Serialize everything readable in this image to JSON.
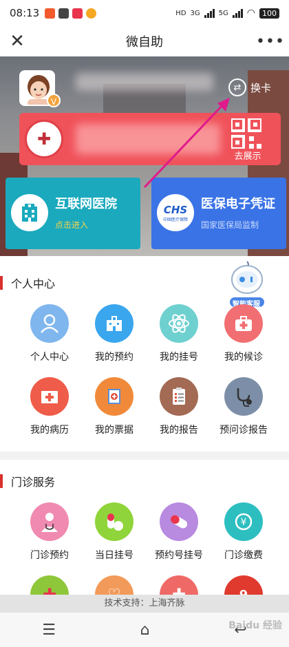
{
  "status_bar": {
    "time": "08:13",
    "network_labels": [
      "HD",
      "3G",
      "5G"
    ],
    "battery": "100"
  },
  "nav": {
    "title": "微自助",
    "close_icon": "close-icon",
    "more_icon": "more-icon"
  },
  "header": {
    "switch_label": "换卡",
    "show_label": "去展示"
  },
  "services": [
    {
      "title": "互联网医院",
      "subtitle": "点击进入",
      "color": "#1aa9bd",
      "subtitle_color": "#f7d34a"
    },
    {
      "title": "医保电子凭证",
      "subtitle": "国家医保局监制",
      "color": "#3a73e6",
      "subtitle_color": "#c9dafc",
      "logo_text": "CHS",
      "logo_sub": "中国医疗保障"
    }
  ],
  "personal": {
    "title": "个人中心",
    "items": [
      {
        "label": "个人中心",
        "icon": "person-icon",
        "color": "#7fb6ee"
      },
      {
        "label": "我的预约",
        "icon": "hospital-building-icon",
        "color": "#3aa6ee"
      },
      {
        "label": "我的挂号",
        "icon": "atom-icon",
        "color": "#6fd0d0"
      },
      {
        "label": "我的候诊",
        "icon": "first-aid-kit-icon",
        "color": "#f16f72"
      },
      {
        "label": "我的病历",
        "icon": "medical-record-icon",
        "color": "#ef5c4a"
      },
      {
        "label": "我的票据",
        "icon": "receipt-icon",
        "color": "#f08a3a"
      },
      {
        "label": "我的报告",
        "icon": "report-clipboard-icon",
        "color": "#a36a54"
      },
      {
        "label": "预问诊报告",
        "icon": "stethoscope-icon",
        "color": "#7d8fa8"
      }
    ]
  },
  "outpatient": {
    "title": "门诊服务",
    "items": [
      {
        "label": "门诊预约",
        "icon": "doctor-icon",
        "color": "#f08ab0"
      },
      {
        "label": "当日挂号",
        "icon": "pills-icon",
        "color": "#8fd43a"
      },
      {
        "label": "预约号挂号",
        "icon": "capsule-icon",
        "color": "#b88ae0"
      },
      {
        "label": "门诊缴费",
        "icon": "yuan-payment-icon",
        "color": "#2dbec0"
      },
      {
        "label": "",
        "icon": "hospital-cross-icon",
        "color": "#8fc73a"
      },
      {
        "label": "",
        "icon": "heartbeat-monitor-icon",
        "color": "#f29a5a"
      },
      {
        "label": "",
        "icon": "medical-kit-icon",
        "color": "#ef6a66"
      },
      {
        "label": "",
        "icon": "ticket-24h-icon",
        "color": "#e03a2e"
      }
    ]
  },
  "robot": {
    "label": "智能客服"
  },
  "footer": {
    "text": "技术支持：上海齐脉"
  },
  "bottom_nav": {
    "menu_icon": "menu-icon",
    "home_icon": "home-icon",
    "back_icon": "back-icon"
  },
  "watermark": "Baidu 经验"
}
